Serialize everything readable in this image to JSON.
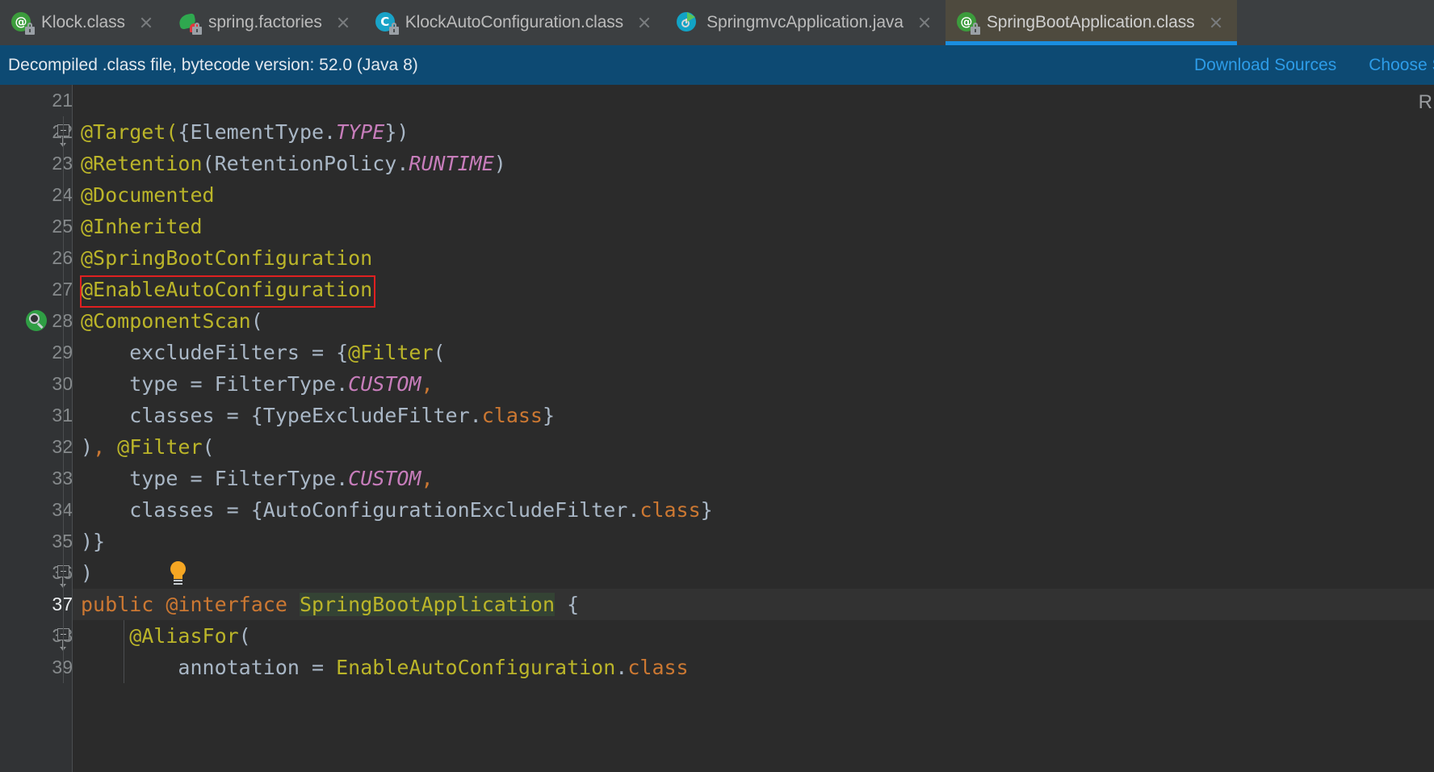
{
  "window": {
    "app": "IntelliJ IDEA",
    "theme_background": "#2b2b2b",
    "tabbar_background": "#3c3f41",
    "active_tab_background": "#4e4a3e",
    "active_tab_underline": "#1a8ee0"
  },
  "tabs": [
    {
      "label": "Klock.class",
      "icon": "annotation-class-icon",
      "locked": true,
      "active": false,
      "close_icon": "close-icon"
    },
    {
      "label": "spring.factories",
      "icon": "spring-leaf-icon",
      "locked": true,
      "active": false,
      "close_icon": "close-icon"
    },
    {
      "label": "KlockAutoConfiguration.class",
      "icon": "java-class-icon",
      "locked": true,
      "active": false,
      "close_icon": "close-icon"
    },
    {
      "label": "SpringmvcApplication.java",
      "icon": "spring-boot-run-icon",
      "locked": false,
      "active": false,
      "close_icon": "close-icon"
    },
    {
      "label": "SpringBootApplication.class",
      "icon": "annotation-class-icon",
      "locked": true,
      "active": true,
      "close_icon": "close-icon"
    }
  ],
  "notification": {
    "message": "Decompiled .class file, bytecode version: 52.0 (Java 8)",
    "background": "#0d4a73",
    "link_color": "#2d9ce8",
    "actions": [
      {
        "label": "Download Sources"
      },
      {
        "label": "Choose Sources..."
      }
    ]
  },
  "editor": {
    "right_hint": "R",
    "caret_line": 37,
    "highlight_box_line": 27,
    "highlight_box_color": "#e02020",
    "caret_word_highlight": "#344334",
    "colors": {
      "annotation": "#bbb529",
      "identifier": "#a9b7c6",
      "static_constant": "#c77dbb",
      "keyword": "#cc7832",
      "line_number": "#868a8c",
      "current_line_number": "#eceff1",
      "gutter_background": "#313335"
    },
    "gutter_icons": [
      {
        "line": 28,
        "icon": "spring-bean-navigate-icon"
      },
      {
        "line": 36,
        "icon": "intention-lightbulb-icon"
      }
    ],
    "fold_markers": [
      22,
      36,
      38
    ],
    "lines": [
      {
        "num": 21,
        "tokens": []
      },
      {
        "num": 22,
        "tokens": [
          {
            "t": "@Target(",
            "c": "ann_paren"
          },
          {
            "t": "{",
            "c": "punct"
          },
          {
            "t": "ElementType.",
            "c": "ident"
          },
          {
            "t": "TYPE",
            "c": "const"
          },
          {
            "t": "}",
            "c": "punct"
          },
          {
            "t": ")",
            "c": "punct"
          }
        ]
      },
      {
        "num": 23,
        "tokens": [
          {
            "t": "@Retention",
            "c": "ann"
          },
          {
            "t": "(RetentionPolicy.",
            "c": "ident"
          },
          {
            "t": "RUNTIME",
            "c": "const"
          },
          {
            "t": ")",
            "c": "punct"
          }
        ]
      },
      {
        "num": 24,
        "tokens": [
          {
            "t": "@Documented",
            "c": "ann"
          }
        ]
      },
      {
        "num": 25,
        "tokens": [
          {
            "t": "@Inherited",
            "c": "ann"
          }
        ]
      },
      {
        "num": 26,
        "tokens": [
          {
            "t": "@SpringBootConfiguration",
            "c": "ann"
          }
        ]
      },
      {
        "num": 27,
        "tokens": [
          {
            "t": "@EnableAutoConfiguration",
            "c": "ann"
          }
        ]
      },
      {
        "num": 28,
        "tokens": [
          {
            "t": "@ComponentScan",
            "c": "ann"
          },
          {
            "t": "(",
            "c": "punct"
          }
        ]
      },
      {
        "num": 29,
        "tokens": [
          {
            "t": "    excludeFilters ",
            "c": "ident"
          },
          {
            "t": "= ",
            "c": "punct"
          },
          {
            "t": "{",
            "c": "punct"
          },
          {
            "t": "@Filter",
            "c": "ann"
          },
          {
            "t": "(",
            "c": "punct"
          }
        ]
      },
      {
        "num": 30,
        "tokens": [
          {
            "t": "    type ",
            "c": "ident"
          },
          {
            "t": "= ",
            "c": "punct"
          },
          {
            "t": "FilterType.",
            "c": "ident"
          },
          {
            "t": "CUSTOM",
            "c": "const"
          },
          {
            "t": ",",
            "c": "comma"
          }
        ]
      },
      {
        "num": 31,
        "tokens": [
          {
            "t": "    classes ",
            "c": "ident"
          },
          {
            "t": "= ",
            "c": "punct"
          },
          {
            "t": "{TypeExcludeFilter.",
            "c": "ident"
          },
          {
            "t": "class",
            "c": "kw"
          },
          {
            "t": "}",
            "c": "punct"
          }
        ]
      },
      {
        "num": 32,
        "tokens": [
          {
            "t": ")",
            "c": "punct"
          },
          {
            "t": ", ",
            "c": "comma"
          },
          {
            "t": "@Filter",
            "c": "ann"
          },
          {
            "t": "(",
            "c": "punct"
          }
        ]
      },
      {
        "num": 33,
        "tokens": [
          {
            "t": "    type ",
            "c": "ident"
          },
          {
            "t": "= ",
            "c": "punct"
          },
          {
            "t": "FilterType.",
            "c": "ident"
          },
          {
            "t": "CUSTOM",
            "c": "const"
          },
          {
            "t": ",",
            "c": "comma"
          }
        ]
      },
      {
        "num": 34,
        "tokens": [
          {
            "t": "    classes ",
            "c": "ident"
          },
          {
            "t": "= ",
            "c": "punct"
          },
          {
            "t": "{AutoConfigurationExcludeFilter.",
            "c": "ident"
          },
          {
            "t": "class",
            "c": "kw"
          },
          {
            "t": "}",
            "c": "punct"
          }
        ]
      },
      {
        "num": 35,
        "tokens": [
          {
            "t": ")}",
            "c": "punct"
          }
        ]
      },
      {
        "num": 36,
        "tokens": [
          {
            "t": ")",
            "c": "punct"
          }
        ]
      },
      {
        "num": 37,
        "tokens": [
          {
            "t": "public ",
            "c": "kw"
          },
          {
            "t": "@interface ",
            "c": "kw"
          },
          {
            "t": "SpringBootApplication",
            "c": "ann_hl"
          },
          {
            "t": " {",
            "c": "punct"
          }
        ]
      },
      {
        "num": 38,
        "tokens": [
          {
            "t": "    @AliasFor",
            "c": "ann"
          },
          {
            "t": "(",
            "c": "punct"
          }
        ]
      },
      {
        "num": 39,
        "tokens": [
          {
            "t": "        annotation ",
            "c": "ident"
          },
          {
            "t": "= ",
            "c": "punct"
          },
          {
            "t": "EnableAutoConfiguration",
            "c": "ann"
          },
          {
            "t": ".",
            "c": "punct"
          },
          {
            "t": "class",
            "c": "kw"
          }
        ]
      }
    ]
  }
}
